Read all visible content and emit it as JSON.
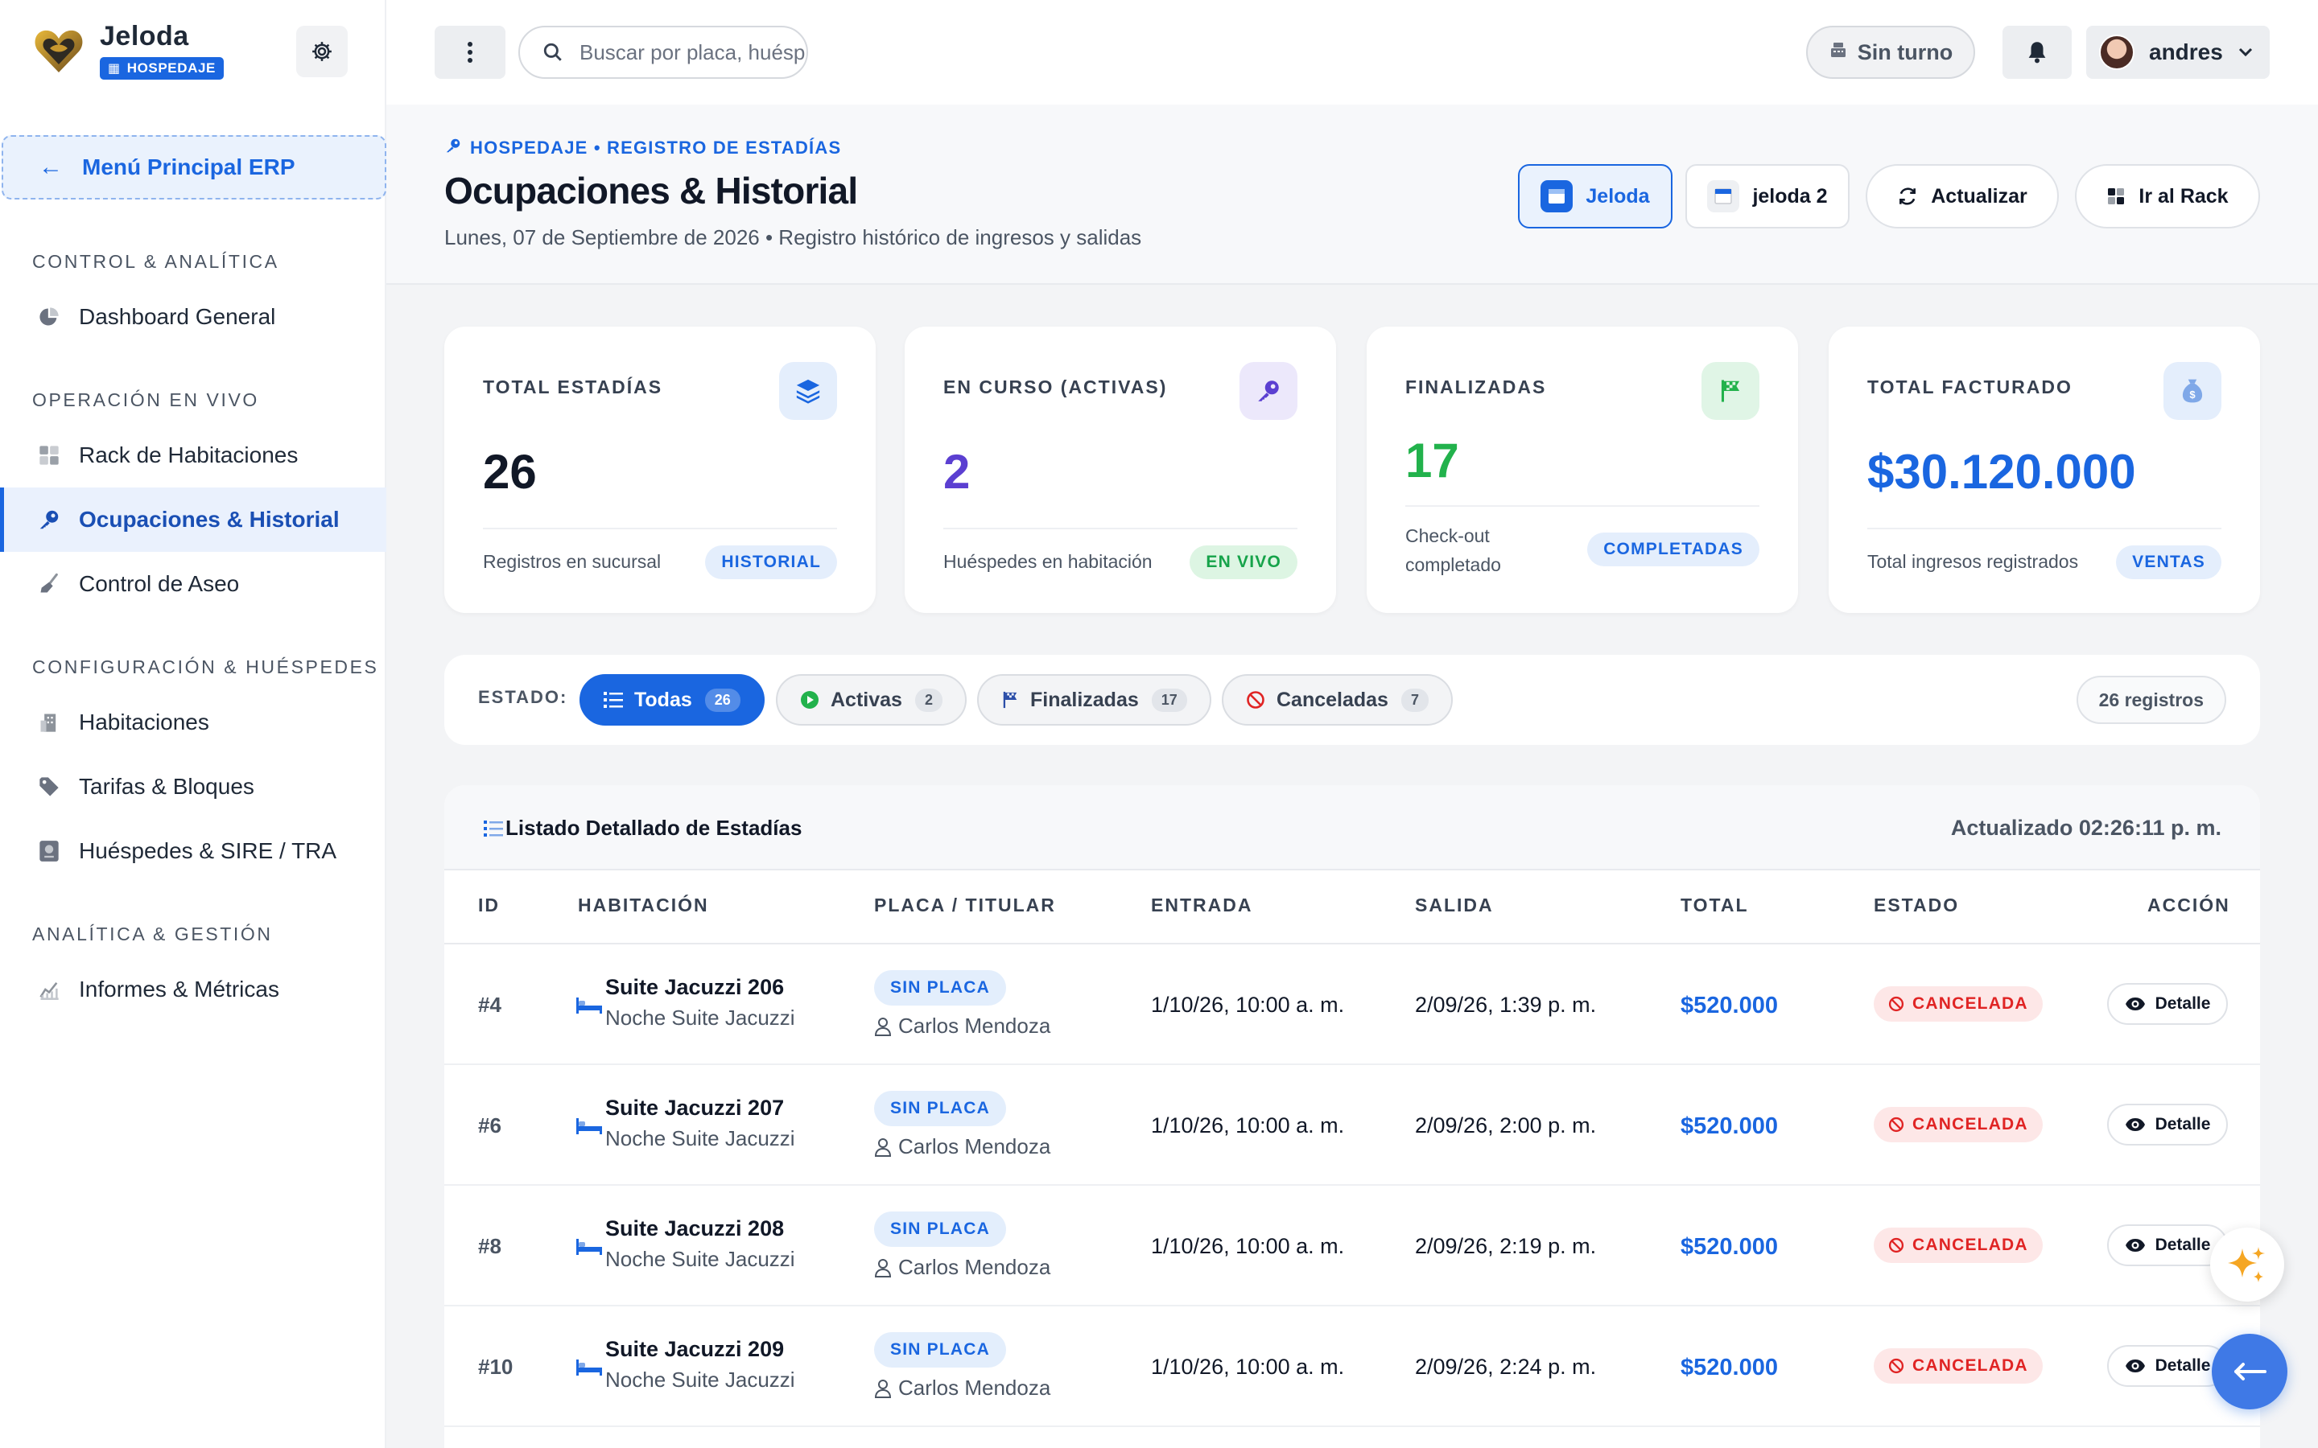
{
  "brand": {
    "name": "Jeloda",
    "badge": "HOSPEDAJE"
  },
  "sidebar": {
    "main_menu_label": "Menú Principal ERP",
    "sections": [
      {
        "title": "CONTROL & ANALÍTICA",
        "items": [
          {
            "label": "Dashboard General",
            "icon": "pie-chart-icon"
          }
        ]
      },
      {
        "title": "OPERACIÓN EN VIVO",
        "items": [
          {
            "label": "Rack de Habitaciones",
            "icon": "grid-icon"
          },
          {
            "label": "Ocupaciones & Historial",
            "icon": "key-icon",
            "active": true
          },
          {
            "label": "Control de Aseo",
            "icon": "broom-icon"
          }
        ]
      },
      {
        "title": "CONFIGURACIÓN & HUÉSPEDES",
        "items": [
          {
            "label": "Habitaciones",
            "icon": "building-icon"
          },
          {
            "label": "Tarifas & Bloques",
            "icon": "tag-icon"
          },
          {
            "label": "Huéspedes & SIRE / TRA",
            "icon": "passport-icon"
          }
        ]
      },
      {
        "title": "ANALÍTICA & GESTIÓN",
        "items": [
          {
            "label": "Informes & Métricas",
            "icon": "line-chart-icon"
          }
        ]
      }
    ]
  },
  "topbar": {
    "search_placeholder": "Buscar por placa, huésped...",
    "shift_label": "Sin turno",
    "user_name": "andres"
  },
  "header": {
    "breadcrumb": "HOSPEDAJE • REGISTRO DE ESTADÍAS",
    "title": "Ocupaciones & Historial",
    "subtitle": "Lunes, 07 de Septiembre de 2026 • Registro histórico de ingresos y salidas",
    "branch_1": "Jeloda",
    "branch_2": "jeloda 2",
    "refresh_label": "Actualizar",
    "rack_label": "Ir al Rack"
  },
  "stats": [
    {
      "label": "TOTAL ESTADÍAS",
      "value": "26",
      "foot": "Registros en sucursal",
      "badge": "HISTORIAL",
      "icon": "layers-icon"
    },
    {
      "label": "EN CURSO (ACTIVAS)",
      "value": "2",
      "foot": "Huéspedes en habitación",
      "badge": "EN VIVO",
      "icon": "key-icon"
    },
    {
      "label": "FINALIZADAS",
      "value": "17",
      "foot": "Check-out completado",
      "badge": "COMPLETADAS",
      "icon": "flag-icon"
    },
    {
      "label": "TOTAL FACTURADO",
      "value": "$30.120.000",
      "foot": "Total ingresos registrados",
      "badge": "VENTAS",
      "icon": "money-bag-icon"
    }
  ],
  "filters": {
    "label": "ESTADO:",
    "chips": [
      {
        "label": "Todas",
        "count": "26"
      },
      {
        "label": "Activas",
        "count": "2"
      },
      {
        "label": "Finalizadas",
        "count": "17"
      },
      {
        "label": "Canceladas",
        "count": "7"
      }
    ],
    "records": "26 registros"
  },
  "table": {
    "title": "Listado Detallado de Estadías",
    "updated": "Actualizado 02:26:11 p. m.",
    "columns": [
      "ID",
      "HABITACIÓN",
      "PLACA / TITULAR",
      "ENTRADA",
      "SALIDA",
      "TOTAL",
      "ESTADO",
      "ACCIÓN"
    ],
    "rows": [
      {
        "id": "#4",
        "room": "Suite Jacuzzi 206",
        "type": "Noche Suite Jacuzzi",
        "plate": "SIN PLACA",
        "holder": "Carlos Mendoza",
        "in": "1/10/26, 10:00 a. m.",
        "out": "2/09/26, 1:39 p. m.",
        "total": "$520.000",
        "status": "CANCELADA",
        "action": "Detalle"
      },
      {
        "id": "#6",
        "room": "Suite Jacuzzi 207",
        "type": "Noche Suite Jacuzzi",
        "plate": "SIN PLACA",
        "holder": "Carlos Mendoza",
        "in": "1/10/26, 10:00 a. m.",
        "out": "2/09/26, 2:00 p. m.",
        "total": "$520.000",
        "status": "CANCELADA",
        "action": "Detalle"
      },
      {
        "id": "#8",
        "room": "Suite Jacuzzi 208",
        "type": "Noche Suite Jacuzzi",
        "plate": "SIN PLACA",
        "holder": "Carlos Mendoza",
        "in": "1/10/26, 10:00 a. m.",
        "out": "2/09/26, 2:19 p. m.",
        "total": "$520.000",
        "status": "CANCELADA",
        "action": "Detalle"
      },
      {
        "id": "#10",
        "room": "Suite Jacuzzi 209",
        "type": "Noche Suite Jacuzzi",
        "plate": "SIN PLACA",
        "holder": "Carlos Mendoza",
        "in": "1/10/26, 10:00 a. m.",
        "out": "2/09/26, 2:24 p. m.",
        "total": "$520.000",
        "status": "CANCELADA",
        "action": "Detalle"
      }
    ]
  },
  "colors": {
    "accent": "#1a66e0",
    "purple": "#5b3fd1",
    "green": "#22b24c",
    "danger": "#e02424"
  }
}
